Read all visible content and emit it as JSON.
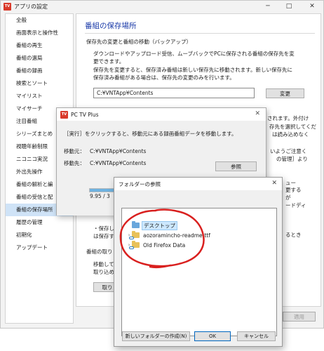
{
  "main": {
    "title": "アプリの設定",
    "controls": {
      "minimize": "─",
      "maximize": "□",
      "close": "✕"
    },
    "sidebar": [
      {
        "label": "全般"
      },
      {
        "label": "画面表示と操作性"
      },
      {
        "label": "番組の再生"
      },
      {
        "label": "番組の選局"
      },
      {
        "label": "番組の録画"
      },
      {
        "label": "検索とソート"
      },
      {
        "label": "マイリスト"
      },
      {
        "label": "マイサーチ"
      },
      {
        "label": "注目番組"
      },
      {
        "label": "シリーズまとめ"
      },
      {
        "label": "視聴年齢制限"
      },
      {
        "label": "ニコニコ実況"
      },
      {
        "label": "外出先操作"
      },
      {
        "label": "番組の解析と編"
      },
      {
        "label": "番組の受信と配"
      },
      {
        "label": "番組の保存場所"
      },
      {
        "label": "履歴の管理"
      },
      {
        "label": "初期化"
      },
      {
        "label": "アップデート"
      }
    ],
    "selected_index": 15,
    "content": {
      "heading": "番組の保存場所",
      "section1": "保存先の変更と番組の移動（バックアップ）",
      "desc1": "ダウンロードやアップロード受信、ムーブバックでPCに保存される番組の保存先を変",
      "desc2": "更できます。",
      "desc3": "保存先を変更すると、保存済み番組は新しい保存先に移動されます。新しい保存先に",
      "desc4": "保存済み番組がある場合は、保存先の変更のみを行います。",
      "path": "C:¥VNTApp¥Contents",
      "change_label": "変更",
      "r1": "されます。外付け",
      "r2": "存先を選択してくだ",
      "r3": "は読み込めなく",
      "r4": "いようご注意く",
      "r5": "の管理］より",
      "r6": "ュー",
      "r7": "更する",
      "r8": "が",
      "r9": "ードディ",
      "note1": "・保存し",
      "note2": "は保存す",
      "note_tail": "るとき",
      "section2": "番組の取り",
      "move1": "移動して",
      "move2": "取り込め",
      "import_label": "取り",
      "apply_label": "適用"
    }
  },
  "pc_dialog": {
    "title": "PC TV Plus",
    "close": "✕",
    "instruction": "［実行］をクリックすると、移動元にある録画番組データを移動します。",
    "src_label": "移動元：",
    "src_path": "C:¥VNTApp¥Contents",
    "dst_label": "移動先：",
    "dst_path": "C:¥VNTApp¥Contents",
    "browse_label": "参照",
    "progress_text": "9.95 / 3",
    "progress_fraction": 0.78
  },
  "browse": {
    "title": "フォルダーの参照",
    "close": "✕",
    "tree": [
      {
        "label": "デスクトップ",
        "icon": "folder-blue-icon",
        "chevron": ""
      },
      {
        "label": "aozoramincho-readme-ttf",
        "icon": "folder-cloud-icon",
        "chevron": "›"
      },
      {
        "label": "Old Firefox Data",
        "icon": "folder-cloud-icon",
        "chevron": "›"
      }
    ],
    "new_folder_label": "新しいフォルダーの作成(N)",
    "ok_label": "OK",
    "cancel_label": "キャンセル"
  },
  "annotation": {
    "color": "#d9201f"
  },
  "colors": {
    "accent": "#1a3aa8",
    "selection": "#cfe3f7",
    "brand": "#d93a2b"
  }
}
